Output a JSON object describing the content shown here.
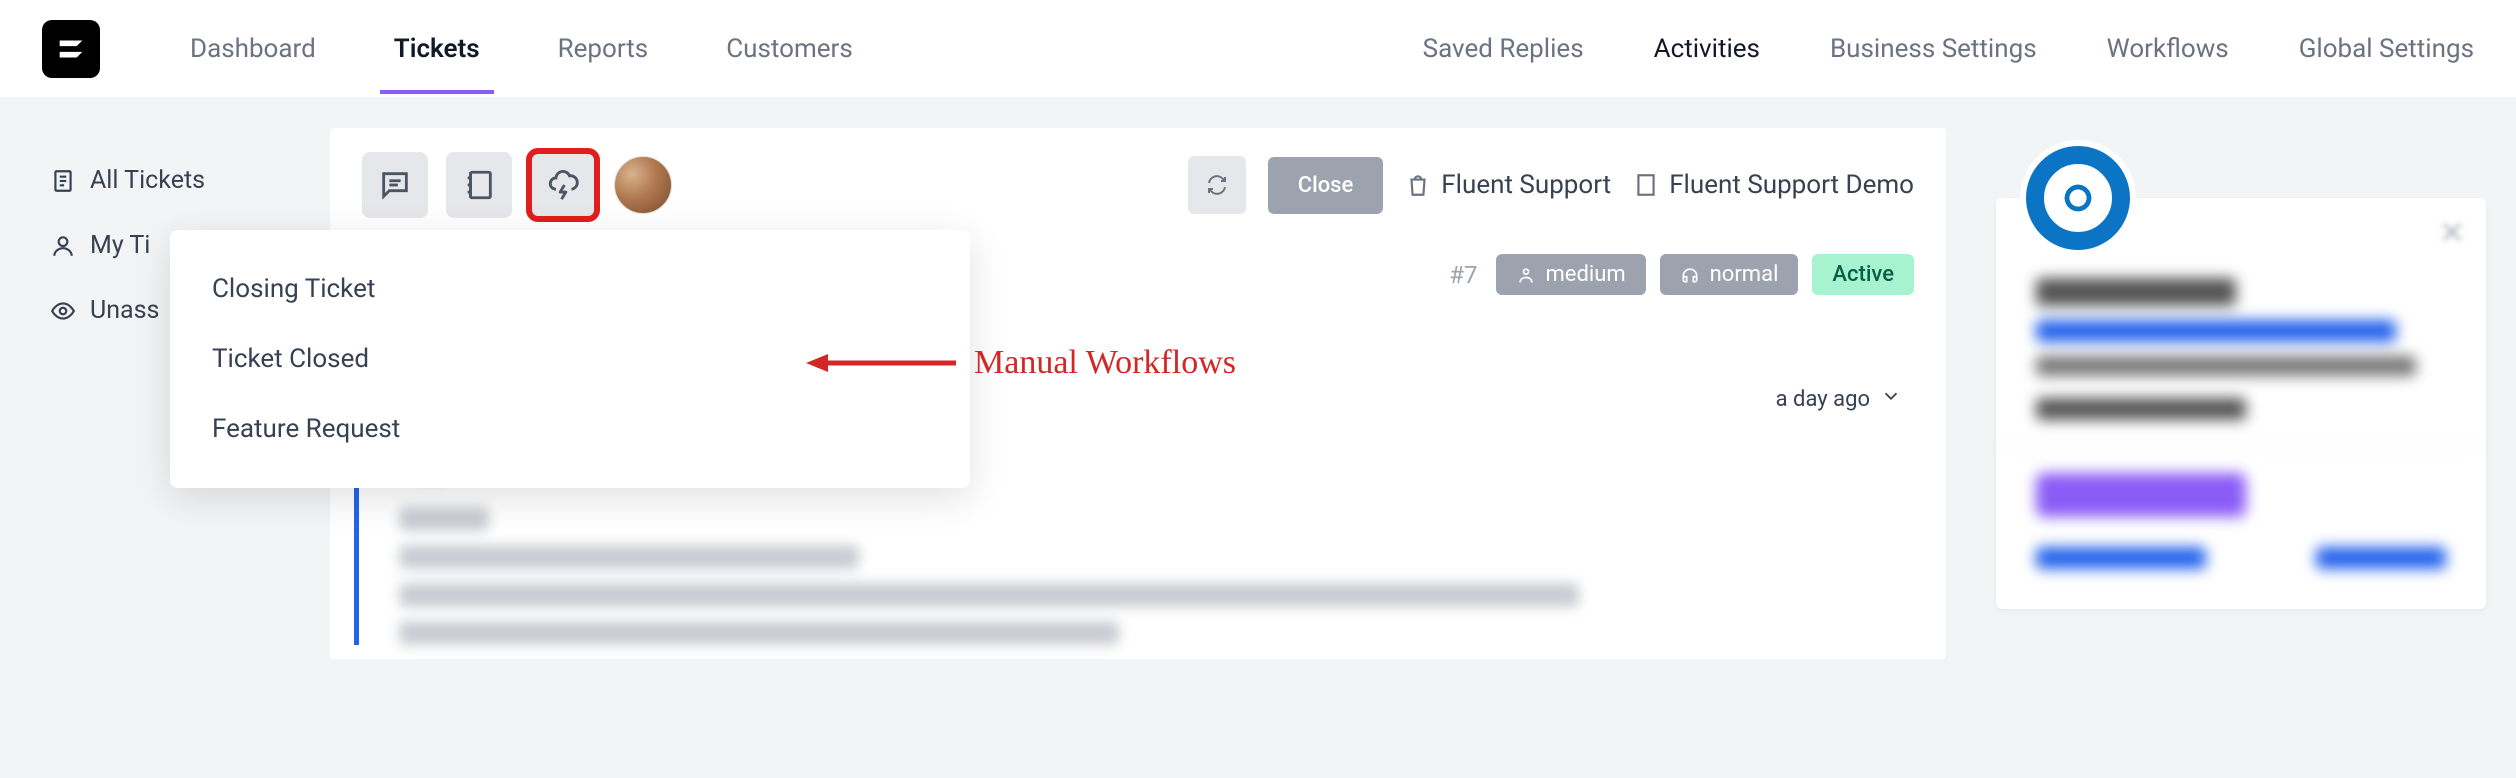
{
  "nav": {
    "left": [
      "Dashboard",
      "Tickets",
      "Reports",
      "Customers"
    ],
    "right": [
      "Saved Replies",
      "Activities",
      "Business Settings",
      "Workflows",
      "Global Settings"
    ],
    "active_left_index": 1,
    "emph_right_index": 1
  },
  "sidebar": {
    "items": [
      {
        "label": "All Tickets",
        "icon": "doc-list-icon"
      },
      {
        "label": "My Ti",
        "icon": "user-icon"
      },
      {
        "label": "Unass",
        "icon": "eye-icon"
      }
    ]
  },
  "toolbar": {
    "close_label": "Close",
    "crumbs": [
      {
        "icon": "shopping-bag-icon",
        "label": "Fluent Support"
      },
      {
        "icon": "building-icon",
        "label": "Fluent Support Demo"
      }
    ]
  },
  "workflow_dropdown": {
    "items": [
      "Closing Ticket",
      "Ticket Closed",
      "Feature Request"
    ]
  },
  "annotation": {
    "label": "Manual Workflows"
  },
  "ticket_meta": {
    "id": "#7",
    "priority": "medium",
    "type": "normal",
    "status": "Active"
  },
  "thread": {
    "time_label": "a day ago"
  }
}
